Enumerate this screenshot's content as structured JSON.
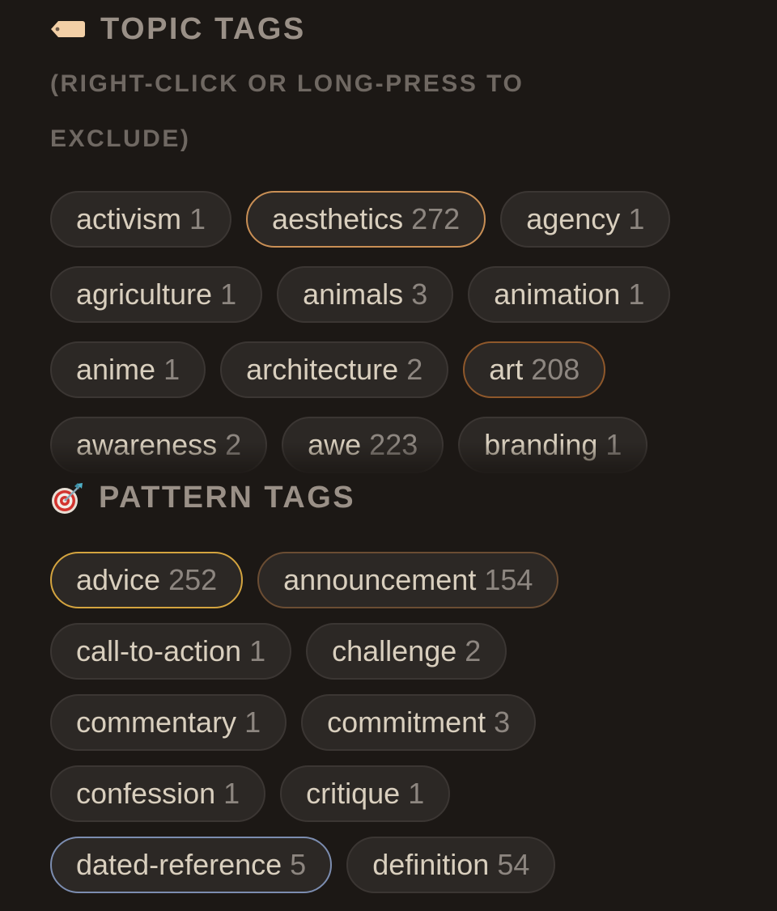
{
  "topic_tags": {
    "title": "TOPIC TAGS",
    "hint": "(RIGHT-CLICK OR LONG-PRESS TO EXCLUDE)",
    "icon": "tag-icon",
    "tags": [
      {
        "name": "activism",
        "count": "1",
        "state": "default"
      },
      {
        "name": "aesthetics",
        "count": "272",
        "state": "active-orange"
      },
      {
        "name": "agency",
        "count": "1",
        "state": "default"
      },
      {
        "name": "agriculture",
        "count": "1",
        "state": "default"
      },
      {
        "name": "animals",
        "count": "3",
        "state": "default"
      },
      {
        "name": "animation",
        "count": "1",
        "state": "default"
      },
      {
        "name": "anime",
        "count": "1",
        "state": "default"
      },
      {
        "name": "architecture",
        "count": "2",
        "state": "default"
      },
      {
        "name": "art",
        "count": "208",
        "state": "active-brown"
      },
      {
        "name": "awareness",
        "count": "2",
        "state": "default"
      },
      {
        "name": "awe",
        "count": "223",
        "state": "default"
      },
      {
        "name": "branding",
        "count": "1",
        "state": "default"
      }
    ]
  },
  "pattern_tags": {
    "title": "PATTERN TAGS",
    "icon": "target-icon",
    "tags": [
      {
        "name": "advice",
        "count": "252",
        "state": "active-gold"
      },
      {
        "name": "announcement",
        "count": "154",
        "state": "active-bronze"
      },
      {
        "name": "call-to-action",
        "count": "1",
        "state": "default"
      },
      {
        "name": "challenge",
        "count": "2",
        "state": "default"
      },
      {
        "name": "commentary",
        "count": "1",
        "state": "default"
      },
      {
        "name": "commitment",
        "count": "3",
        "state": "default"
      },
      {
        "name": "confession",
        "count": "1",
        "state": "default"
      },
      {
        "name": "critique",
        "count": "1",
        "state": "default"
      },
      {
        "name": "dated-reference",
        "count": "5",
        "state": "active-blue"
      },
      {
        "name": "definition",
        "count": "54",
        "state": "default"
      }
    ]
  },
  "colors": {
    "background": "#1c1815",
    "chip_background": "#2c2825",
    "chip_border": "#3b3633",
    "accent_orange": "#c98f55",
    "accent_brown": "#8f582b",
    "accent_gold": "#d4a43f",
    "accent_bronze": "#6b4d33",
    "accent_blue": "#7c8db0"
  }
}
